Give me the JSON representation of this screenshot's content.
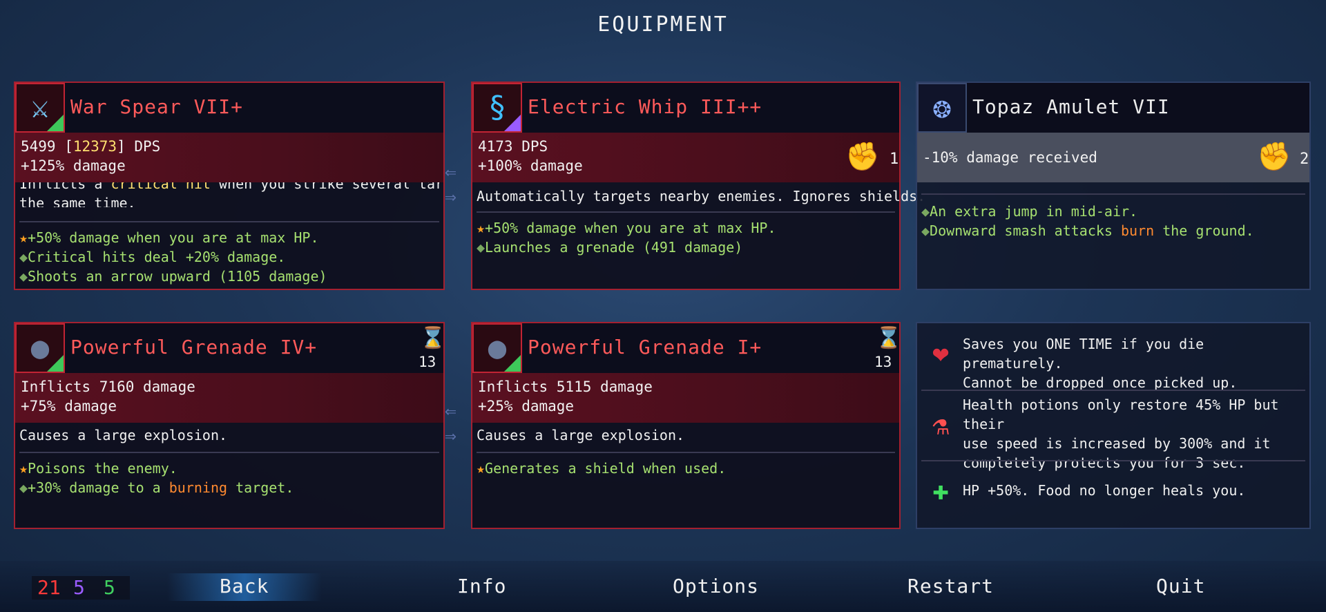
{
  "screen_title": "EQUIPMENT",
  "weapons": [
    {
      "name": "War Spear VII+",
      "icon": "spear-icon",
      "stat1_a": "5499 [",
      "stat1_b": "12373",
      "stat1_c": "] DPS",
      "stat2": "+125% damage",
      "desc_line1_a": "Inflicts a ",
      "desc_line1_b": "critical hit",
      "desc_line1_c": " when you strike several targets at",
      "desc_line2": "the same time.",
      "perks": [
        "+50% damage when you are at max HP.",
        "Critical hits deal +20% damage.",
        "Shoots an arrow upward (1105 damage)"
      ]
    },
    {
      "name": "Electric Whip III++",
      "icon": "whip-icon",
      "stat1": "4173 DPS",
      "stat2": "+100% damage",
      "scroll_count": "1",
      "desc": "Automatically targets nearby enemies. Ignores shields.",
      "perks": [
        "+50% damage when you are at max HP.",
        "Launches a grenade (491 damage)"
      ]
    }
  ],
  "amulet": {
    "name": "Topaz Amulet VII",
    "icon": "amulet-icon",
    "stat1": "-10% damage received",
    "scroll_count": "2",
    "perk1": "An extra jump in mid-air.",
    "perk2_a": "Downward smash attacks ",
    "perk2_b": "burn",
    "perk2_c": " the ground."
  },
  "skills": [
    {
      "name": "Powerful Grenade IV+",
      "icon": "grenade-icon",
      "cooldown": "13",
      "stat1": "Inflicts 7160 damage",
      "stat2": "+75% damage",
      "desc": "Causes a large explosion.",
      "perk1": "Poisons the enemy.",
      "perk2_a": "+30% damage to a ",
      "perk2_b": "burning",
      "perk2_c": " target."
    },
    {
      "name": "Powerful Grenade I+",
      "icon": "grenade-icon",
      "cooldown": "13",
      "stat1": "Inflicts 5115 damage",
      "stat2": "+25% damage",
      "desc": "Causes a large explosion.",
      "perk1": "Generates a shield when used."
    }
  ],
  "mutations": [
    {
      "icon": "heart-icon",
      "line1": "Saves you ONE TIME if you die prematurely.",
      "line2": "Cannot be dropped once picked up."
    },
    {
      "icon": "potion-icon",
      "line1": "Health potions only restore 45% HP but their",
      "line2": "use speed is increased by 300% and it",
      "line3": "completely protects you for 3 sec."
    },
    {
      "icon": "food-plus-icon",
      "line1": "HP +50%. Food no longer heals you."
    }
  ],
  "scrolls": {
    "brutality": "21",
    "tactics": "5",
    "survival": "5"
  },
  "colors": {
    "brutality": "#ff3a3a",
    "tactics": "#9a5cff",
    "survival": "#40d060"
  },
  "nav": {
    "back": "Back",
    "info": "Info",
    "options": "Options",
    "restart": "Restart",
    "quit": "Quit"
  }
}
